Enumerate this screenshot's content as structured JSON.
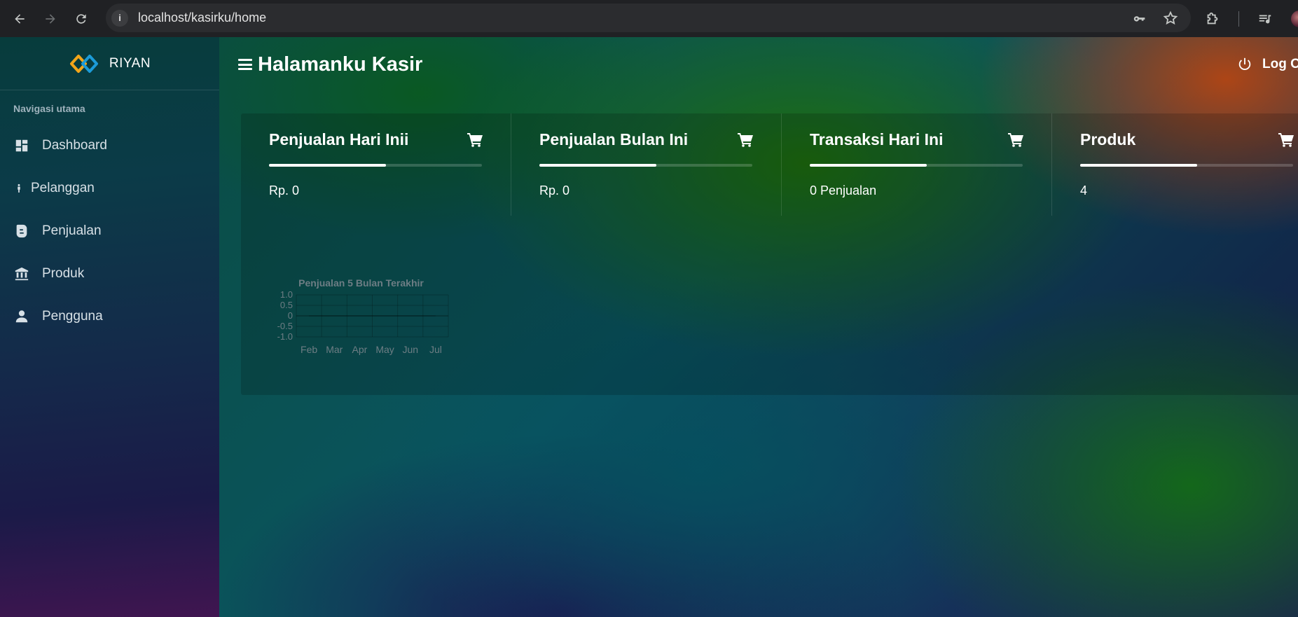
{
  "browser": {
    "url": "localhost/kasirku/home"
  },
  "sidebar": {
    "brand": "RIYAN",
    "nav_caption": "Navigasi utama",
    "items": [
      {
        "label": "Dashboard",
        "icon": "dashboard-icon"
      },
      {
        "label": "Pelanggan",
        "icon": "person-icon"
      },
      {
        "label": "Penjualan",
        "icon": "blog-icon"
      },
      {
        "label": "Produk",
        "icon": "bank-icon"
      },
      {
        "label": "Pengguna",
        "icon": "user-icon"
      }
    ]
  },
  "header": {
    "title": "Halamanku Kasir",
    "logout_label": "Log Out"
  },
  "stats": [
    {
      "title": "Penjualan Hari Inii",
      "value": "Rp. 0",
      "progress": 0.55,
      "icon": "cart-icon"
    },
    {
      "title": "Penjualan Bulan Ini",
      "value": "Rp. 0",
      "progress": 0.55,
      "icon": "cart-icon"
    },
    {
      "title": "Transaksi Hari Ini",
      "value": "0 Penjualan",
      "progress": 0.55,
      "icon": "cart-icon"
    },
    {
      "title": "Produk",
      "value": "4",
      "progress": 0.55,
      "icon": "cart-icon"
    }
  ],
  "chart_data": {
    "type": "line",
    "title": "Penjualan 5 Bulan Terakhir",
    "categories": [
      "Feb",
      "Mar",
      "Apr",
      "May",
      "Jun",
      "Jul"
    ],
    "series": [
      {
        "values": [
          0,
          0,
          0,
          0,
          0,
          0
        ]
      }
    ],
    "ylim": [
      -1.0,
      1.0
    ],
    "yticks": [
      "1.0",
      "0.5",
      "0",
      "-0.5",
      "-1.0"
    ],
    "grid": true,
    "xlabel": "",
    "ylabel": ""
  },
  "colors": {
    "accent": "#ffffff",
    "chart_text": "#6d7d84"
  }
}
